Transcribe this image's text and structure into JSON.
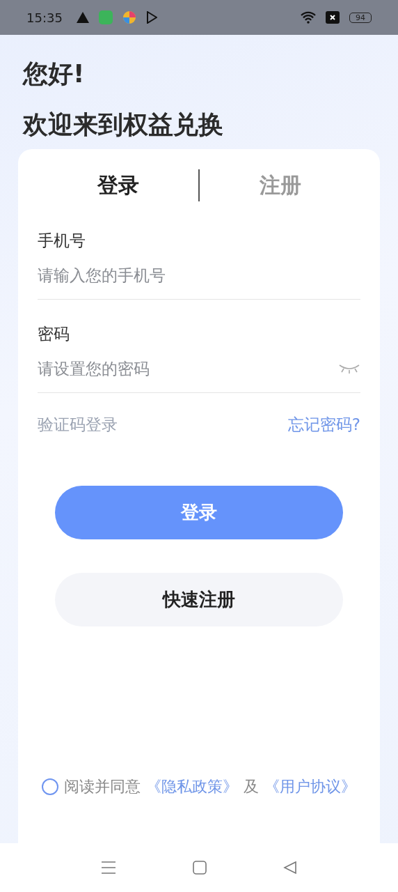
{
  "status_bar": {
    "time": "15:35",
    "battery": "94"
  },
  "header": {
    "greeting": "您好!",
    "title": "欢迎来到权益兑换"
  },
  "tabs": [
    {
      "label": "登录",
      "selected": true
    },
    {
      "label": "注册",
      "selected": false
    }
  ],
  "fields": [
    {
      "label": "手机号",
      "placeholder": "请输入您的手机号",
      "kind": "text"
    },
    {
      "label": "密码",
      "placeholder": "请设置您的密码",
      "kind": "password"
    }
  ],
  "links": {
    "sms_login": "验证码登录",
    "forgot_password": "忘记密码?"
  },
  "buttons": {
    "login": "登录",
    "quick_register": "快速注册"
  },
  "agreement": {
    "checked": false,
    "text": "阅读并同意",
    "privacy": "《隐私政策》",
    "conjunction": "及",
    "terms": "《用户协议》"
  }
}
